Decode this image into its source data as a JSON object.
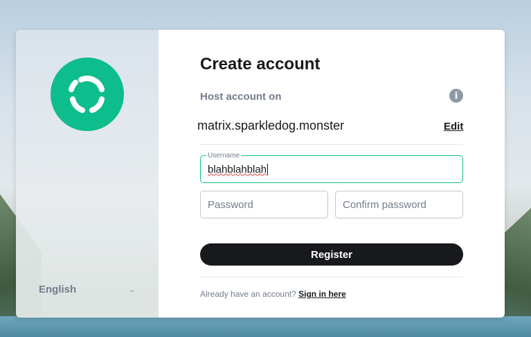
{
  "language": {
    "selected": "English"
  },
  "form": {
    "title": "Create account",
    "host_label": "Host account on",
    "server_name": "matrix.sparkledog.monster",
    "edit_label": "Edit",
    "username": {
      "legend": "Username",
      "value": "blahblahblah"
    },
    "password": {
      "placeholder": "Password"
    },
    "confirm_password": {
      "placeholder": "Confirm password"
    },
    "register_label": "Register",
    "signin_prompt": "Already have an account?",
    "signin_link": "Sign in here"
  },
  "colors": {
    "brand": "#0dbd8b",
    "button": "#17191c",
    "muted_text": "#737d8c"
  },
  "icons": {
    "logo": "element-logo",
    "info": "info-icon",
    "chevron": "chevron-down-icon"
  }
}
